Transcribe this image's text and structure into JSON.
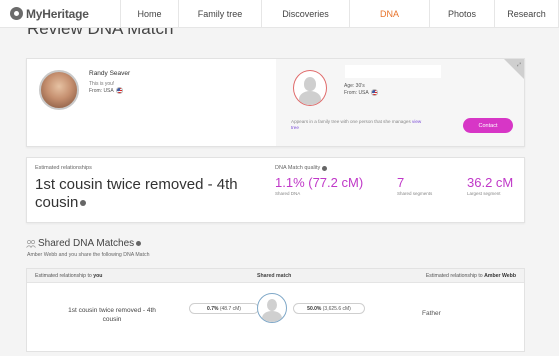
{
  "nav": {
    "logo_text": "MyHeritage",
    "items": [
      {
        "label": "Home",
        "active": false
      },
      {
        "label": "Family tree",
        "active": false
      },
      {
        "label": "Discoveries",
        "active": false
      },
      {
        "label": "DNA",
        "active": true
      },
      {
        "label": "Photos",
        "active": false
      },
      {
        "label": "Research",
        "active": false
      }
    ],
    "active_color": "#e8732a"
  },
  "page_title": "Review DNA Match",
  "match_card": {
    "you": {
      "name": "Randy Seaver",
      "subtitle": "This is you!",
      "from_label": "From: USA"
    },
    "match": {
      "age_label": "Age: 30's",
      "from_label": "From: USA",
      "appears_text": "Appears in a family tree with one person that she manages",
      "view_tree_link": "view tree"
    },
    "contact_button": "Contact",
    "accent_color": "#d736c6"
  },
  "estimates": {
    "relationship_label": "Estimated relationships",
    "relationship_value": "1st cousin twice removed - 4th cousin",
    "quality_label": "DNA Match quality",
    "shared_dna_value": "1.1% (77.2 cM)",
    "shared_dna_label": "Shared DNA",
    "shared_segments_value": "7",
    "shared_segments_label": "Shared segments",
    "largest_segment_value": "36.2 cM",
    "largest_segment_label": "Largest segment",
    "value_color": "#c038c8"
  },
  "shared_matches": {
    "title": "Shared DNA Matches",
    "subtitle": "Amber Webb and you share the following DNA Match",
    "col1_prefix": "Estimated relationship to ",
    "col1_bold": "you",
    "col2": "Shared match",
    "col3_prefix": "Estimated relationship to ",
    "col3_bold": "Amber Webb",
    "rows": [
      {
        "relationship_to_you": "1st cousin twice removed - 4th cousin",
        "left_pct": "0.7%",
        "left_cm": "(48.7 cM)",
        "right_pct": "50.0%",
        "right_cm": "(3,625.6 cM)",
        "relationship_to_match": "Father"
      }
    ]
  }
}
